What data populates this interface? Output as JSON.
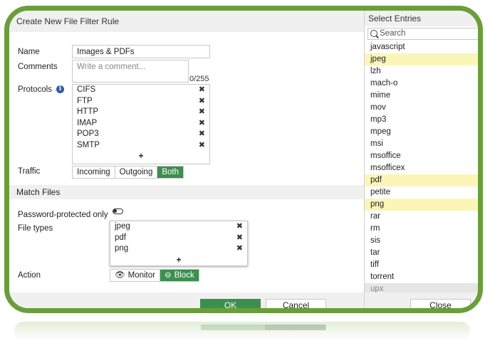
{
  "dialog": {
    "title": "Create New File Filter Rule",
    "name_label": "Name",
    "name_value": "Images & PDFs",
    "comments_label": "Comments",
    "comments_placeholder": "Write a comment...",
    "comments_counter": "0/255",
    "protocols_label": "Protocols",
    "protocols": [
      "CIFS",
      "FTP",
      "HTTP",
      "IMAP",
      "POP3",
      "SMTP"
    ],
    "traffic_label": "Traffic",
    "traffic_options": [
      "Incoming",
      "Outgoing",
      "Both"
    ],
    "traffic_selected": "Both",
    "match_files_header": "Match Files",
    "password_label": "Password-protected only",
    "password_enabled": false,
    "file_types_label": "File types",
    "file_types": [
      "jpeg",
      "pdf",
      "png"
    ],
    "action_label": "Action",
    "action_monitor": "Monitor",
    "action_block": "Block",
    "action_selected": "Block",
    "ok_label": "OK",
    "cancel_label": "Cancel",
    "add_symbol": "+",
    "remove_symbol": "✖"
  },
  "panel": {
    "title": "Select Entries",
    "search_placeholder": "Search",
    "entries": [
      {
        "label": "javascript",
        "selected": false
      },
      {
        "label": "jpeg",
        "selected": true
      },
      {
        "label": "lzh",
        "selected": false
      },
      {
        "label": "mach-o",
        "selected": false
      },
      {
        "label": "mime",
        "selected": false
      },
      {
        "label": "mov",
        "selected": false
      },
      {
        "label": "mp3",
        "selected": false
      },
      {
        "label": "mpeg",
        "selected": false
      },
      {
        "label": "msi",
        "selected": false
      },
      {
        "label": "msoffice",
        "selected": false
      },
      {
        "label": "msofficex",
        "selected": false
      },
      {
        "label": "pdf",
        "selected": true
      },
      {
        "label": "petite",
        "selected": false
      },
      {
        "label": "png",
        "selected": true
      },
      {
        "label": "rar",
        "selected": false
      },
      {
        "label": "rm",
        "selected": false
      },
      {
        "label": "sis",
        "selected": false
      },
      {
        "label": "tar",
        "selected": false
      },
      {
        "label": "tiff",
        "selected": false
      },
      {
        "label": "torrent",
        "selected": false
      },
      {
        "label": "upx",
        "selected": false
      }
    ],
    "close_label": "Close"
  },
  "colors": {
    "frame_green": "#6a9e3a",
    "accent_green": "#3c8f4f",
    "selected_yellow": "#fbf6b8"
  }
}
